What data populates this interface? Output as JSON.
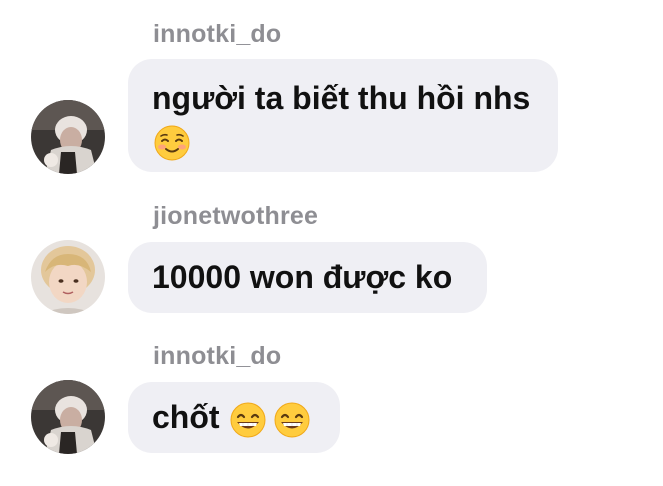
{
  "messages": [
    {
      "sender": "innotki_do",
      "text_line1": "người ta biết thu hồi nhs",
      "emojis": [
        "smiling-blush-emoji"
      ]
    },
    {
      "sender": "jionetwothree",
      "text_line1": "10000 won được ko",
      "emojis": []
    },
    {
      "sender": "innotki_do",
      "text_line1": "chốt",
      "emojis": [
        "grinning-emoji",
        "grinning-emoji"
      ]
    }
  ],
  "colors": {
    "bubble": "#efeff4",
    "sender": "#8e8e93",
    "text": "#111111"
  }
}
